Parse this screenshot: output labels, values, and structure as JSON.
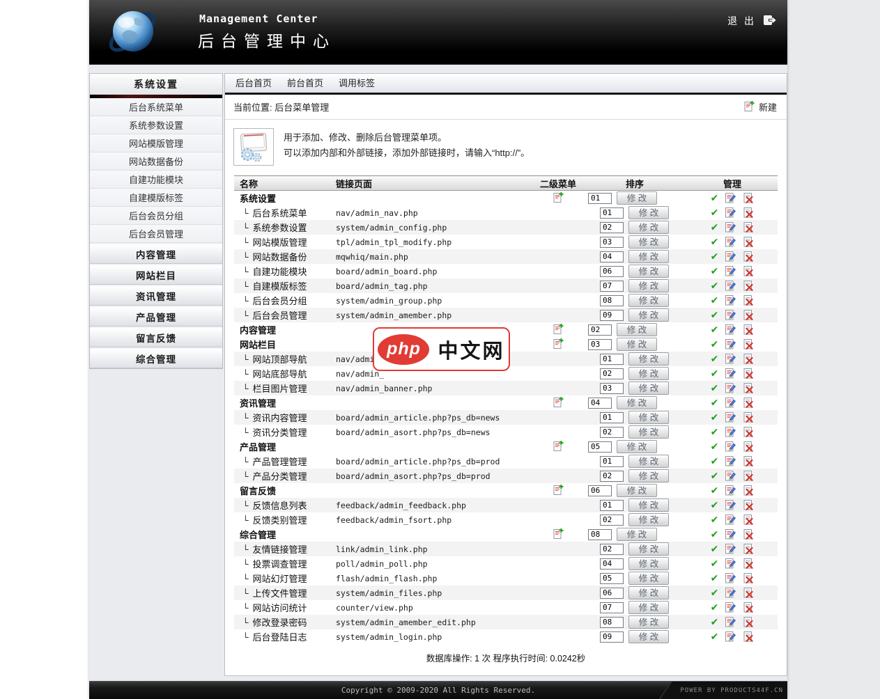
{
  "header": {
    "title_en": "Management Center",
    "title_zh": "后台管理中心",
    "logout_label": "退 出"
  },
  "sidebar": {
    "active_header": "系统设置",
    "items": [
      "后台系统菜单",
      "系统参数设置",
      "网站模版管理",
      "网站数据备份",
      "自建功能模块",
      "自建模版标签",
      "后台会员分组",
      "后台会员管理"
    ],
    "sections": [
      "内容管理",
      "网站栏目",
      "资讯管理",
      "产品管理",
      "留言反馈",
      "综合管理"
    ]
  },
  "content": {
    "tabs": [
      "后台首页",
      "前台首页",
      "调用标签"
    ],
    "breadcrumb": "当前位置: 后台菜单管理",
    "new_button_label": "新建",
    "info": {
      "line1": "用于添加、修改、删除后台管理菜单项。",
      "line2": "可以添加内部和外部链接，添加外部链接时，请输入“http://”。"
    },
    "table": {
      "headers": [
        "名称",
        "链接页面",
        "二级菜单",
        "排序",
        "管理"
      ],
      "modify_label": "修 改",
      "rows": [
        {
          "name": "系统设置",
          "link": "",
          "level": 0,
          "sort": "01",
          "shaded": false
        },
        {
          "name": "后台系统菜单",
          "link": "nav/admin_nav.php",
          "level": 1,
          "sort": "01",
          "shaded": false
        },
        {
          "name": "系统参数设置",
          "link": "system/admin_config.php",
          "level": 1,
          "sort": "02",
          "shaded": true
        },
        {
          "name": "网站模版管理",
          "link": "tpl/admin_tpl_modify.php",
          "level": 1,
          "sort": "03",
          "shaded": false
        },
        {
          "name": "网站数据备份",
          "link": "mqwhiq/main.php",
          "level": 1,
          "sort": "04",
          "shaded": true
        },
        {
          "name": "自建功能模块",
          "link": "board/admin_board.php",
          "level": 1,
          "sort": "06",
          "shaded": false
        },
        {
          "name": "自建模版标签",
          "link": "board/admin_tag.php",
          "level": 1,
          "sort": "07",
          "shaded": true
        },
        {
          "name": "后台会员分组",
          "link": "system/admin_group.php",
          "level": 1,
          "sort": "08",
          "shaded": false
        },
        {
          "name": "后台会员管理",
          "link": "system/admin_amember.php",
          "level": 1,
          "sort": "09",
          "shaded": true
        },
        {
          "name": "内容管理",
          "link": "",
          "level": 0,
          "sort": "02",
          "shaded": false
        },
        {
          "name": "网站栏目",
          "link": "",
          "level": 0,
          "sort": "03",
          "shaded": false
        },
        {
          "name": "网站顶部导航",
          "link": "nav/admin",
          "level": 1,
          "sort": "01",
          "shaded": true
        },
        {
          "name": "网站底部导航",
          "link": "nav/admin_",
          "level": 1,
          "sort": "02",
          "shaded": false
        },
        {
          "name": "栏目图片管理",
          "link": "nav/admin_banner.php",
          "level": 1,
          "sort": "03",
          "shaded": true
        },
        {
          "name": "资讯管理",
          "link": "",
          "level": 0,
          "sort": "04",
          "shaded": false
        },
        {
          "name": "资讯内容管理",
          "link": "board/admin_article.php?ps_db=news",
          "level": 1,
          "sort": "01",
          "shaded": true
        },
        {
          "name": "资讯分类管理",
          "link": "board/admin_asort.php?ps_db=news",
          "level": 1,
          "sort": "02",
          "shaded": false
        },
        {
          "name": "产品管理",
          "link": "",
          "level": 0,
          "sort": "05",
          "shaded": false
        },
        {
          "name": "产品管理管理",
          "link": "board/admin_article.php?ps_db=prod",
          "level": 1,
          "sort": "01",
          "shaded": false
        },
        {
          "name": "产品分类管理",
          "link": "board/admin_asort.php?ps_db=prod",
          "level": 1,
          "sort": "02",
          "shaded": true
        },
        {
          "name": "留言反馈",
          "link": "",
          "level": 0,
          "sort": "06",
          "shaded": false
        },
        {
          "name": "反馈信息列表",
          "link": "feedback/admin_feedback.php",
          "level": 1,
          "sort": "01",
          "shaded": true
        },
        {
          "name": "反馈类别管理",
          "link": "feedback/admin_fsort.php",
          "level": 1,
          "sort": "02",
          "shaded": false
        },
        {
          "name": "综合管理",
          "link": "",
          "level": 0,
          "sort": "08",
          "shaded": false
        },
        {
          "name": "友情链接管理",
          "link": "link/admin_link.php",
          "level": 1,
          "sort": "02",
          "shaded": true
        },
        {
          "name": "投票调查管理",
          "link": "poll/admin_poll.php",
          "level": 1,
          "sort": "04",
          "shaded": false
        },
        {
          "name": "网站幻灯管理",
          "link": "flash/admin_flash.php",
          "level": 1,
          "sort": "05",
          "shaded": false
        },
        {
          "name": "上传文件管理",
          "link": "system/admin_files.php",
          "level": 1,
          "sort": "06",
          "shaded": true
        },
        {
          "name": "网站访问统计",
          "link": "counter/view.php",
          "level": 1,
          "sort": "07",
          "shaded": false
        },
        {
          "name": "修改登录密码",
          "link": "system/admin_amember_edit.php",
          "level": 1,
          "sort": "08",
          "shaded": true
        },
        {
          "name": "后台登陆日志",
          "link": "system/admin_login.php",
          "level": 1,
          "sort": "09",
          "shaded": false
        }
      ]
    },
    "stats_text": "数据库操作: 1 次 程序执行时间: 0.0242秒"
  },
  "watermark": {
    "badge_text": "php",
    "site_text": "中文网"
  },
  "footer": {
    "copyright": "Copyright © 2009-2020 All Rights Reserved.",
    "power": "POWER BY PRODUCTS44F.CN"
  },
  "icons": {
    "check": "✔",
    "tree_branch": "└"
  },
  "colors": {
    "check_green": "#1fa01f",
    "delete_red": "#d2352a",
    "pencil_blue": "#4a7ad4",
    "watermark_red": "#e03c34"
  }
}
